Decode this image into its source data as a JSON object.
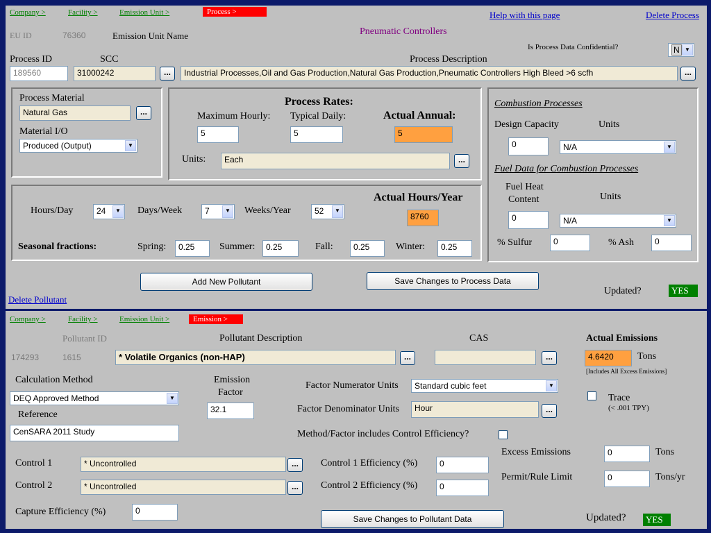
{
  "process": {
    "breadcrumbs": [
      "Company >",
      "Facility >",
      "Emission Unit >",
      "Process >"
    ],
    "help_link": "Help with this page",
    "delete_process": "Delete Process",
    "eu_id_label": "EU ID",
    "eu_id_value": "76360",
    "eu_name_label": "Emission Unit Name",
    "eu_name_value": "Pneumatic Controllers",
    "confidential_label": "Is Process Data Confidential?",
    "confidential_value": "N",
    "process_id_label": "Process ID",
    "process_id_value": "189560",
    "scc_label": "SCC",
    "scc_value": "31000242",
    "desc_label": "Process Description",
    "desc_value": "Industrial Processes,Oil and Gas Production,Natural Gas Production,Pneumatic Controllers High Bleed >6 scfh",
    "material_label": "Process Material",
    "material_value": "Natural Gas",
    "material_io_label": "Material I/O",
    "material_io_value": "Produced (Output)",
    "rates_title": "Process Rates:",
    "max_hourly_label": "Maximum Hourly:",
    "max_hourly_value": "5",
    "typical_daily_label": "Typical Daily:",
    "typical_daily_value": "5",
    "actual_annual_label": "Actual Annual:",
    "actual_annual_value": "5",
    "units_label": "Units:",
    "units_value": "Each",
    "combustion_title": "Combustion Processes",
    "design_capacity_label": "Design Capacity",
    "design_units_label": "Units",
    "design_capacity_value": "0",
    "design_units_value": "N/A",
    "fuel_title": "Fuel Data for Combustion Processes",
    "fuel_heat_label": "Fuel Heat",
    "fuel_content_label": "Content",
    "fuel_units_label": "Units",
    "fuel_heat_value": "0",
    "fuel_units_value": "N/A",
    "sulfur_label": "% Sulfur",
    "sulfur_value": "0",
    "ash_label": "% Ash",
    "ash_value": "0",
    "actual_hours_label": "Actual Hours/Year",
    "actual_hours_value": "8760",
    "hours_day_label": "Hours/Day",
    "hours_day_value": "24",
    "days_week_label": "Days/Week",
    "days_week_value": "7",
    "weeks_year_label": "Weeks/Year",
    "weeks_year_value": "52",
    "seasonal_label": "Seasonal fractions:",
    "spring_label": "Spring:",
    "spring_value": "0.25",
    "summer_label": "Summer:",
    "summer_value": "0.25",
    "fall_label": "Fall:",
    "fall_value": "0.25",
    "winter_label": "Winter:",
    "winter_value": "0.25",
    "add_pollutant": "Add New Pollutant",
    "save_process": "Save Changes to Process Data",
    "updated_label": "Updated?",
    "updated_value": "YES",
    "delete_pollutant": "Delete Pollutant",
    "dots": "..."
  },
  "emission": {
    "breadcrumbs": [
      "Company >",
      "Facility >",
      "Emission Unit >",
      "Emission >"
    ],
    "pollutant_id_label": "Pollutant ID",
    "emission_id_value": "174293",
    "pollutant_id_value": "1615",
    "desc_label": "Pollutant Description",
    "desc_value": "* Volatile Organics (non-HAP)",
    "cas_label": "CAS",
    "cas_value": "",
    "actual_label": "Actual Emissions",
    "actual_value": "4.6420",
    "actual_units": "Tons",
    "actual_note": "[Includes All Excess Emissions]",
    "calc_method_label": "Calculation Method",
    "calc_method_value": "DEQ Approved Method",
    "emission_factor_label_1": "Emission",
    "emission_factor_label_2": "Factor",
    "emission_factor_value": "32.1",
    "reference_label": "Reference",
    "reference_value": "CenSARA 2011 Study",
    "numerator_label": "Factor Numerator Units",
    "numerator_value": "Standard cubic feet",
    "denominator_label": "Factor Denominator Units",
    "denominator_value": "Hour",
    "trace_label": "Trace",
    "trace_note": "(< .001 TPY)",
    "control_eff_question": "Method/Factor includes Control Efficiency?",
    "control1_label": "Control 1",
    "control1_value": "* Uncontrolled",
    "control2_label": "Control 2",
    "control2_value": "* Uncontrolled",
    "control1_eff_label": "Control 1 Efficiency (%)",
    "control1_eff_value": "0",
    "control2_eff_label": "Control 2 Efficiency (%)",
    "control2_eff_value": "0",
    "excess_label": "Excess Emissions",
    "excess_value": "0",
    "excess_units": "Tons",
    "permit_label": "Permit/Rule Limit",
    "permit_value": "0",
    "permit_units": "Tons/yr",
    "capture_label": "Capture Efficiency (%)",
    "capture_value": "0",
    "save_pollutant": "Save Changes to Pollutant Data",
    "updated_label": "Updated?",
    "updated_value": "YES"
  }
}
